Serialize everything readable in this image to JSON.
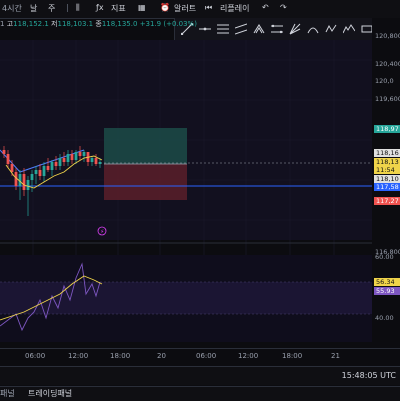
{
  "toolbar": {
    "interval": "4시간",
    "day": "날",
    "week": "주",
    "indicators": "지표",
    "alerts": "알러트",
    "replay": "리플레이"
  },
  "ohlc": {
    "high_label": "고",
    "high": "118,152.1",
    "low_label": "저",
    "low": "118,103.1",
    "close_label": "종",
    "close": "118,135.0",
    "change": "+31.9 (+0.03%)"
  },
  "price_scale": [
    "120,800",
    "120,400",
    "120,0",
    "119,600",
    "116,800"
  ],
  "price_tags": [
    {
      "text": "118,97",
      "color": "#26a69a"
    },
    {
      "text": "118,16",
      "color": "#e0e0e0"
    },
    {
      "text": "118,13",
      "color": "#f0d44a"
    },
    {
      "text": "11:54",
      "color": "#f0d44a"
    },
    {
      "text": "118,10",
      "color": "#e0e0e0"
    },
    {
      "text": "117,58",
      "color": "#2962ff"
    },
    {
      "text": "117,27",
      "color": "#ef5350"
    }
  ],
  "rsi_scale": [
    "60.00",
    "40.00"
  ],
  "rsi_tags": [
    {
      "text": "56.34",
      "color": "#f0d44a"
    },
    {
      "text": "55.93",
      "color": "#7e57c2"
    }
  ],
  "time_axis": [
    "06:00",
    "12:00",
    "18:00",
    "20",
    "06:00",
    "12:00",
    "18:00",
    "21"
  ],
  "clock": "15:48:05 UTC",
  "bottom_panel_title": "트레이딩패널",
  "colors": {
    "up": "#26a69a",
    "down": "#ef5350",
    "hline": "#2962ff",
    "ma": "#f0d44a",
    "rsi": "#7e57c2"
  }
}
